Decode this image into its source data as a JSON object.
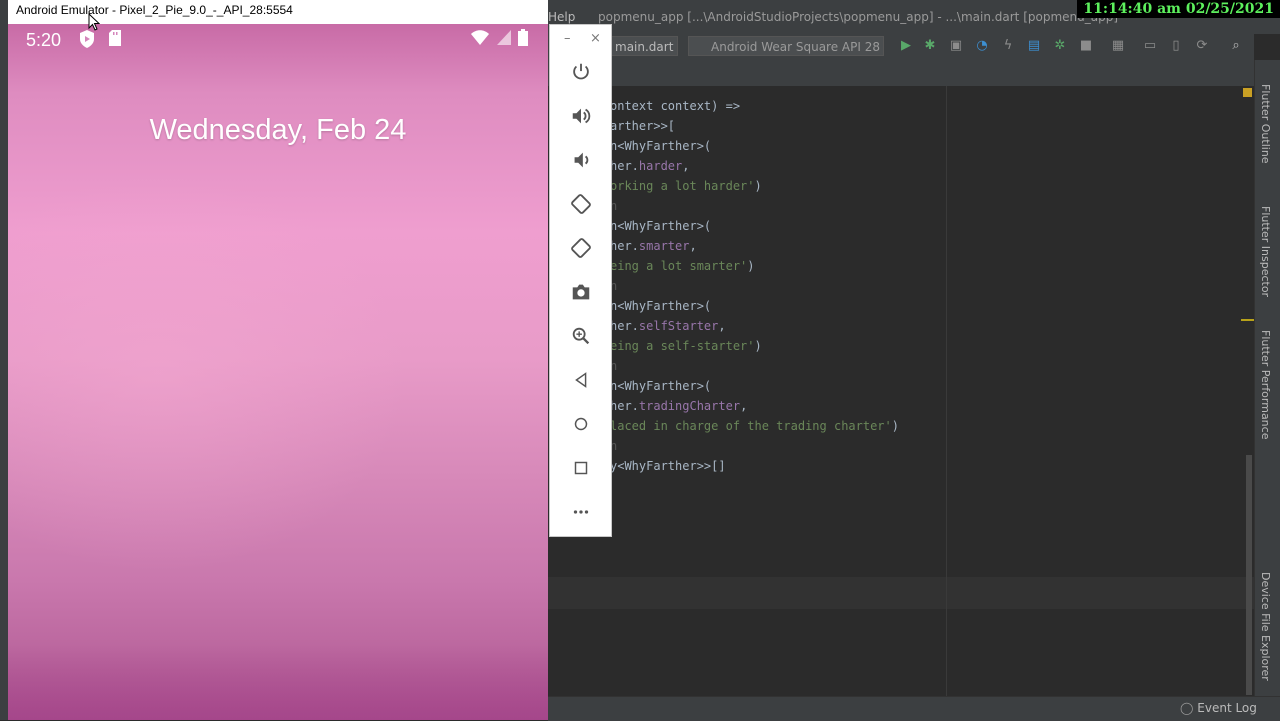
{
  "emulator": {
    "window_title": "Android Emulator - Pixel_2_Pie_9.0_-_API_28:5554",
    "status_time": "5:20",
    "lock_date": "Wednesday, Feb 24",
    "status_icons": [
      "shield-play-icon",
      "sd-card-icon",
      "wifi-icon",
      "cell-signal-icon",
      "battery-icon"
    ],
    "panel": {
      "minimize": "–",
      "close": "×",
      "buttons": [
        "power",
        "volume-up",
        "volume-down",
        "rotate-left",
        "rotate-right",
        "screenshot",
        "zoom",
        "back",
        "home",
        "overview",
        "more"
      ]
    }
  },
  "ide": {
    "help_menu": "Help",
    "title": "popmenu_app [...\\AndroidStudioProjects\\popmenu_app] - ...\\main.dart [popmenu_app]",
    "file_selector": "main.dart",
    "device_selector": "Android Wear Square API 28",
    "code_lines": [
      {
        "parts": [
          {
            "t": "ontext context) =>",
            "c": ""
          }
        ]
      },
      {
        "parts": [
          {
            "t": "arther>>[",
            "c": ""
          }
        ]
      },
      {
        "parts": [
          {
            "t": "n<WhyFarther>(",
            "c": ""
          }
        ]
      },
      {
        "parts": [
          {
            "t": "her.",
            "c": ""
          },
          {
            "t": "harder",
            "c": "c-field"
          },
          {
            "t": ",",
            "c": ""
          }
        ]
      },
      {
        "parts": [
          {
            "t": "orking a lot harder'",
            "c": "c-str"
          },
          {
            "t": ")",
            "c": ""
          }
        ]
      },
      {
        "parts": [
          {
            "t": "n",
            "c": "c-fade"
          }
        ]
      },
      {
        "parts": [
          {
            "t": "n<WhyFarther>(",
            "c": ""
          }
        ]
      },
      {
        "parts": [
          {
            "t": "her.",
            "c": ""
          },
          {
            "t": "smarter",
            "c": "c-field"
          },
          {
            "t": ",",
            "c": ""
          }
        ]
      },
      {
        "parts": [
          {
            "t": "eing a lot smarter'",
            "c": "c-str"
          },
          {
            "t": ")",
            "c": ""
          }
        ]
      },
      {
        "parts": [
          {
            "t": "n",
            "c": "c-fade"
          }
        ]
      },
      {
        "parts": [
          {
            "t": "n<WhyFarther>(",
            "c": ""
          }
        ]
      },
      {
        "parts": [
          {
            "t": "her.",
            "c": ""
          },
          {
            "t": "selfStarter",
            "c": "c-field"
          },
          {
            "t": ",",
            "c": ""
          }
        ]
      },
      {
        "parts": [
          {
            "t": "eing a self-starter'",
            "c": "c-str"
          },
          {
            "t": ")",
            "c": ""
          }
        ]
      },
      {
        "parts": [
          {
            "t": "n",
            "c": "c-fade"
          }
        ]
      },
      {
        "parts": [
          {
            "t": "n<WhyFarther>(",
            "c": ""
          }
        ]
      },
      {
        "parts": [
          {
            "t": "her.",
            "c": ""
          },
          {
            "t": "tradingCharter",
            "c": "c-field"
          },
          {
            "t": ",",
            "c": ""
          }
        ]
      },
      {
        "parts": [
          {
            "t": "laced in charge of the trading charter'",
            "c": "c-str"
          },
          {
            "t": ")",
            "c": ""
          }
        ]
      },
      {
        "parts": [
          {
            "t": "n",
            "c": "c-fade"
          }
        ]
      },
      {
        "parts": [
          {
            "t": "y<WhyFarther>>[]",
            "c": ""
          }
        ]
      }
    ],
    "right_tabs": [
      "Flutter Outline",
      "Flutter Inspector",
      "Flutter Performance",
      "Device File Explorer"
    ],
    "event_log": "Event Log"
  },
  "clock": "11:14:40 am 02/25/2021",
  "colors": {
    "ide_bg": "#2b2b2b",
    "ide_chrome": "#3c3f41",
    "string": "#6a8759",
    "field": "#9876aa",
    "code": "#a9b7c6",
    "clock_fg": "#5df05d"
  }
}
